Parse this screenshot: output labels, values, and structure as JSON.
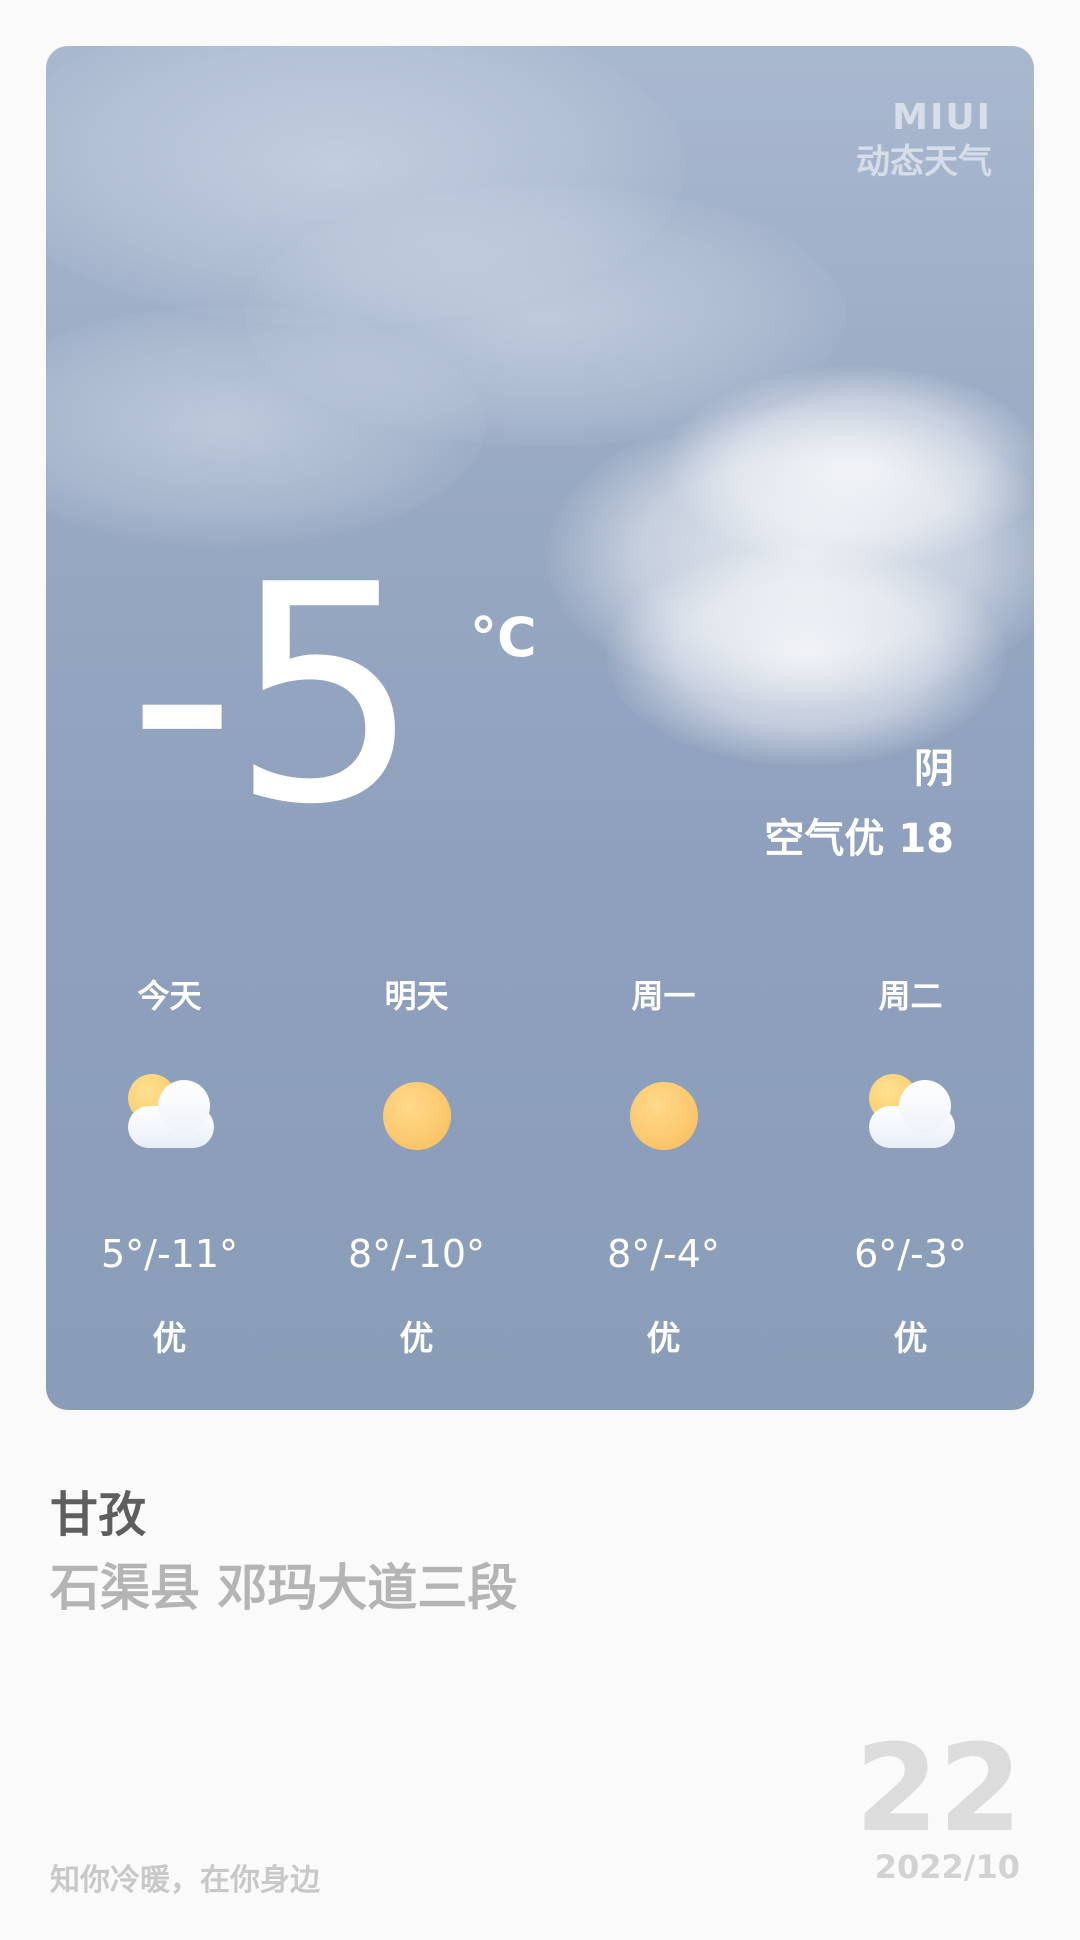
{
  "brand": {
    "line1": "MIUI",
    "line2": "动态天气"
  },
  "current": {
    "temperature": "-5",
    "unit": "°C",
    "condition": "阴",
    "air_quality": "空气优 18"
  },
  "forecast": [
    {
      "label": "今天",
      "icon": "sun-behind-cloud-icon",
      "range": "5°/-11°",
      "aqi": "优"
    },
    {
      "label": "明天",
      "icon": "sun-icon",
      "range": "8°/-10°",
      "aqi": "优"
    },
    {
      "label": "周一",
      "icon": "sun-icon",
      "range": "8°/-4°",
      "aqi": "优"
    },
    {
      "label": "周二",
      "icon": "sun-behind-cloud-icon",
      "range": "6°/-3°",
      "aqi": "优"
    }
  ],
  "location": {
    "city": "甘孜",
    "address": "石渠县 邓玛大道三段"
  },
  "footer": {
    "slogan": "知你冷暖，在你身边",
    "day": "22",
    "year_month": "2022/10"
  },
  "colors": {
    "sky_top": "#a9b8cf",
    "sky_bottom": "#8a9db8",
    "sun": "#fbc86e"
  }
}
